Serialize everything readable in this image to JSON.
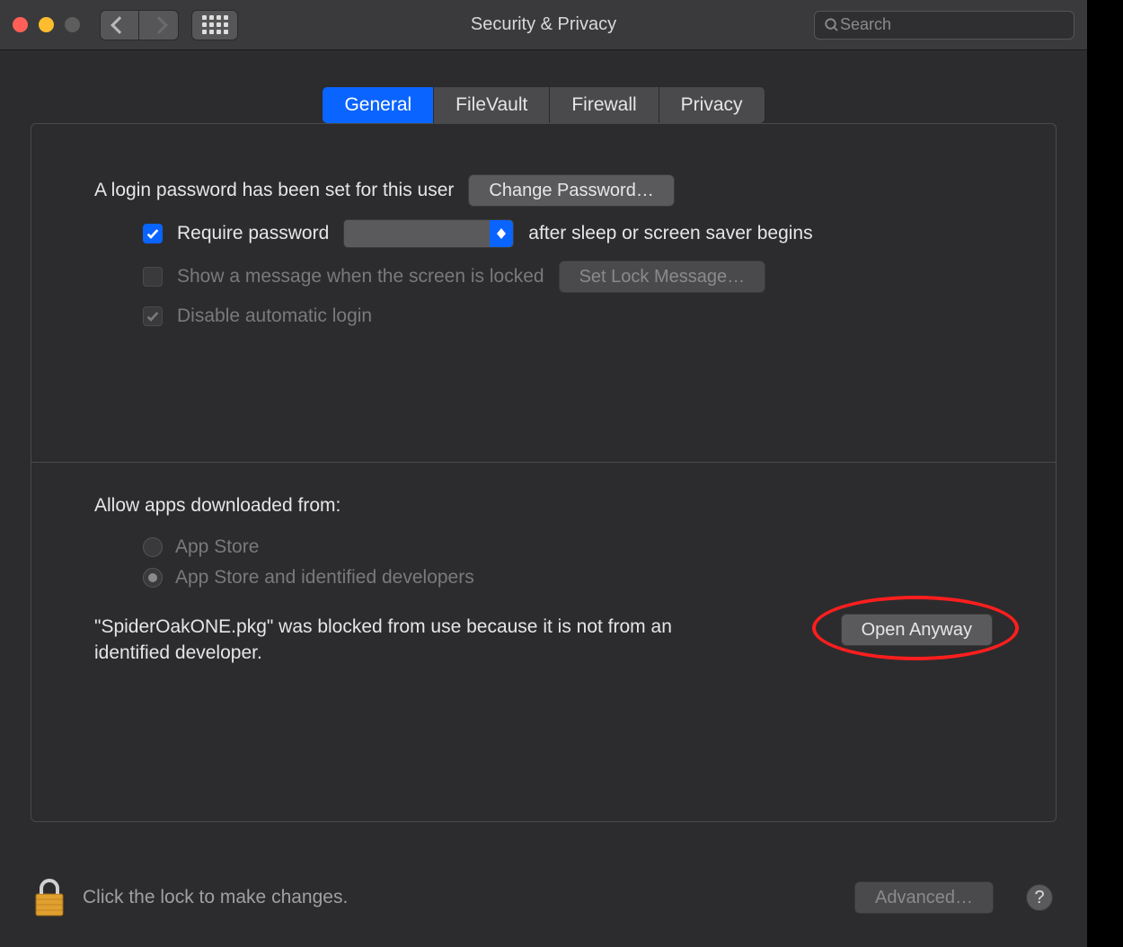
{
  "window": {
    "title": "Security & Privacy"
  },
  "search": {
    "placeholder": "Search"
  },
  "tabs": [
    {
      "label": "General"
    },
    {
      "label": "FileVault"
    },
    {
      "label": "Firewall"
    },
    {
      "label": "Privacy"
    }
  ],
  "general": {
    "login_password_set": "A login password has been set for this user",
    "change_password": "Change Password…",
    "require_password": "Require password",
    "after_sleep": "after sleep or screen saver begins",
    "show_message": "Show a message when the screen is locked",
    "set_lock_message": "Set Lock Message…",
    "disable_auto_login": "Disable automatic login"
  },
  "allow": {
    "heading": "Allow apps downloaded from:",
    "option_appstore": "App Store",
    "option_identified": "App Store and identified developers",
    "blocked_message": "\"SpiderOakONE.pkg\" was blocked from use because it is not from an identified developer.",
    "open_anyway": "Open Anyway"
  },
  "footer": {
    "lock_text": "Click the lock to make changes.",
    "advanced": "Advanced…",
    "help": "?"
  }
}
